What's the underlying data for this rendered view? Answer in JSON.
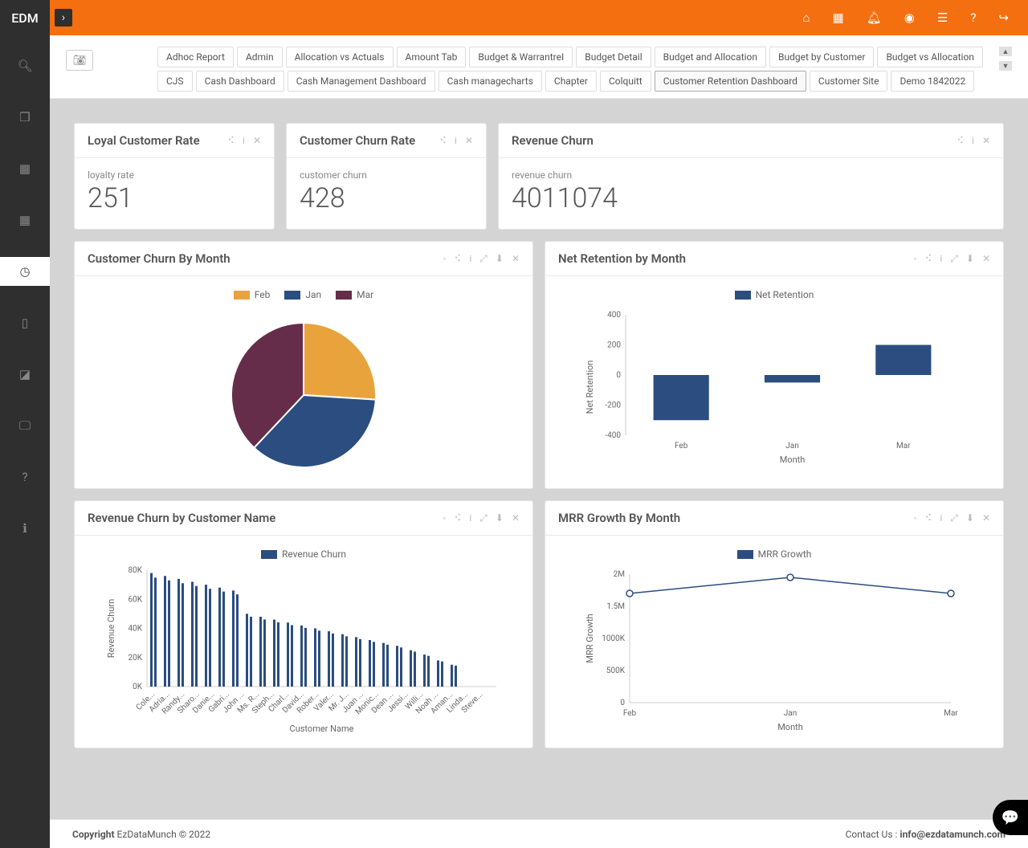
{
  "brand": "EDM",
  "tabs": {
    "row1": [
      "Adhoc Report",
      "Admin",
      "Allocation vs Actuals",
      "Amount Tab",
      "Budget & WarrantreI",
      "Budget Detail",
      "Budget and Allocation",
      "Budget by Customer",
      "Budget vs Allocation"
    ],
    "row2": [
      "CJS",
      "Cash Dashboard",
      "Cash Management Dashboard",
      "Cash managecharts",
      "Chapter",
      "Colquitt",
      "Customer Retention Dashboard",
      "Customer Site",
      "Demo 1842022"
    ]
  },
  "active_tab": "Customer Retention Dashboard",
  "kpis": [
    {
      "title": "Loyal Customer Rate",
      "label": "loyalty rate",
      "value": "251"
    },
    {
      "title": "Customer Churn Rate",
      "label": "customer churn",
      "value": "428"
    },
    {
      "title": "Revenue Churn",
      "label": "revenue churn",
      "value": "4011074"
    }
  ],
  "charts": {
    "churn_by_month": {
      "title": "Customer Churn By Month",
      "legend": [
        "Feb",
        "Jan",
        "Mar"
      ]
    },
    "net_retention": {
      "title": "Net Retention by Month",
      "legend": "Net Retention",
      "xlabel": "Month",
      "ylabel": "Net Retention"
    },
    "revenue_churn_by_customer": {
      "title": "Revenue Churn by Customer Name",
      "legend": "Revenue Churn",
      "xlabel": "Customer Name",
      "ylabel": "Revenue Churn"
    },
    "mrr_growth": {
      "title": "MRR Growth By Month",
      "legend": "MRR Growth",
      "xlabel": "Month",
      "ylabel": "MRR Growth"
    }
  },
  "chart_data": [
    {
      "id": "churn_by_month",
      "type": "pie",
      "title": "Customer Churn By Month",
      "series": [
        {
          "name": "Feb",
          "value": 26,
          "color": "#e8a33d"
        },
        {
          "name": "Jan",
          "value": 36,
          "color": "#2b4d80"
        },
        {
          "name": "Mar",
          "value": 38,
          "color": "#662d4a"
        }
      ]
    },
    {
      "id": "net_retention",
      "type": "bar",
      "title": "Net Retention by Month",
      "categories": [
        "Feb",
        "Jan",
        "Mar"
      ],
      "values": [
        -300,
        -50,
        200
      ],
      "xlabel": "Month",
      "ylabel": "Net Retention",
      "ylim": [
        -400,
        400
      ],
      "color": "#2b4d80"
    },
    {
      "id": "revenue_churn_by_customer",
      "type": "bar",
      "title": "Revenue Churn by Customer Name",
      "categories": [
        "Cole...",
        "Adria...",
        "Randy...",
        "Sharo...",
        "Danie...",
        "Gabri...",
        "John ...",
        "Ms. R...",
        "Steph...",
        "Charl...",
        "David...",
        "Rober...",
        "Valer...",
        "Mr. J...",
        "Juan ...",
        "Monic...",
        "Dean ...",
        "Jessi...",
        "Willi...",
        "Noah ...",
        "Aman...",
        "Linda...",
        "Steve..."
      ],
      "values": [
        78000,
        76000,
        74000,
        72000,
        70000,
        68000,
        66000,
        50000,
        48000,
        46000,
        44000,
        42000,
        40000,
        38000,
        36000,
        34000,
        32000,
        30000,
        28000,
        25000,
        22000,
        18000,
        15000
      ],
      "xlabel": "Customer Name",
      "ylabel": "Revenue Churn",
      "ylim": [
        0,
        80000
      ],
      "color": "#2b4d80"
    },
    {
      "id": "mrr_growth",
      "type": "line",
      "title": "MRR Growth By Month",
      "categories": [
        "Feb",
        "Jan",
        "Mar"
      ],
      "values": [
        1700000,
        1950000,
        1700000
      ],
      "xlabel": "Month",
      "ylabel": "MRR Growth",
      "ylim": [
        0,
        2000000
      ],
      "color": "#2b4d80"
    }
  ],
  "footer": {
    "copyright_bold": "Copyright",
    "copyright_rest": " EzDataMunch © 2022",
    "contact_label": "Contact Us : ",
    "contact_email": "info@ezdatamunch.com"
  }
}
